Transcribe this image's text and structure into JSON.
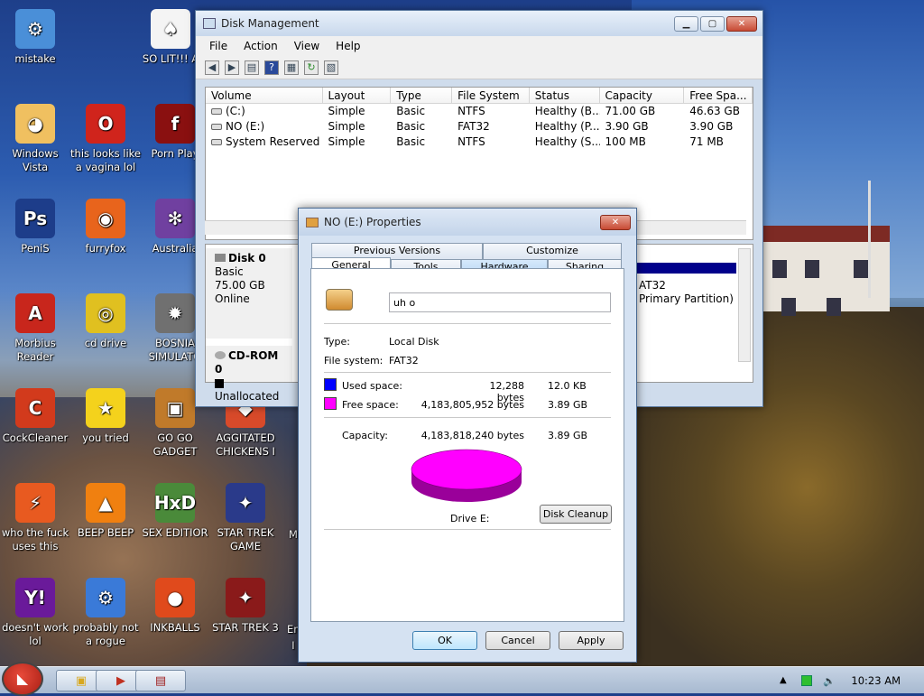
{
  "desktop": {
    "icons": [
      {
        "label": "mistake",
        "glyph": "⚙",
        "color": "#4a8fd8"
      },
      {
        "label": "SO LIT!!! A",
        "glyph": "♠",
        "color": "#f4f4f4"
      },
      {
        "label": "Windows Vista",
        "glyph": "◕",
        "color": "#f0c060"
      },
      {
        "label": "this looks like a vagina lol",
        "glyph": "O",
        "color": "#d0241c"
      },
      {
        "label": "Porn Play",
        "glyph": "f",
        "color": "#8a1010"
      },
      {
        "label": "PeniS",
        "glyph": "Ps",
        "color": "#1d3d8a"
      },
      {
        "label": "furryfox",
        "glyph": "◉",
        "color": "#e8641c"
      },
      {
        "label": "Australia",
        "glyph": "✻",
        "color": "#7040a0"
      },
      {
        "label": "Morbius Reader",
        "glyph": "A",
        "color": "#c8261c"
      },
      {
        "label": "cd drive",
        "glyph": "◎",
        "color": "#e0c020"
      },
      {
        "label": "BOSNIA SIMULATO",
        "glyph": "✹",
        "color": "#707070"
      },
      {
        "label": "CockCleaner",
        "glyph": "C",
        "color": "#d23a1c"
      },
      {
        "label": "you tried",
        "glyph": "★",
        "color": "#f4d21c"
      },
      {
        "label": "GO GO GADGET",
        "glyph": "▣",
        "color": "#c07a2a"
      },
      {
        "label": "AGGITATED CHICKENS I",
        "glyph": "◆",
        "color": "#d84a2a"
      },
      {
        "label": "who the fuck uses this",
        "glyph": "⚡",
        "color": "#e85a20"
      },
      {
        "label": "BEEP BEEP",
        "glyph": "▲",
        "color": "#f08010"
      },
      {
        "label": "SEX EDITIOR",
        "glyph": "HxD",
        "color": "#4a8a3a"
      },
      {
        "label": "STAR TREK GAME",
        "glyph": "✦",
        "color": "#2a3a8a"
      },
      {
        "label": "doesn't work lol",
        "glyph": "Y!",
        "color": "#6a1a9a"
      },
      {
        "label": "probably not a rogue",
        "glyph": "⚙",
        "color": "#3a7ad8"
      },
      {
        "label": "INKBALLS",
        "glyph": "●",
        "color": "#e04a1c"
      },
      {
        "label": "STAR TREK 3",
        "glyph": "✦",
        "color": "#8a1a1a"
      }
    ],
    "cut_labels": [
      "M",
      "Em",
      "I"
    ]
  },
  "disk_mgmt": {
    "title": "Disk Management",
    "menu": [
      "File",
      "Action",
      "View",
      "Help"
    ],
    "toolbar_icons": [
      "back-icon",
      "forward-icon",
      "view-icon",
      "help-icon",
      "properties-icon",
      "refresh-icon",
      "settings-icon"
    ],
    "columns": [
      "Volume",
      "Layout",
      "Type",
      "File System",
      "Status",
      "Capacity",
      "Free Spa..."
    ],
    "rows": [
      [
        "(C:)",
        "Simple",
        "Basic",
        "NTFS",
        "Healthy (B...",
        "71.00 GB",
        "46.63 GB"
      ],
      [
        "NO (E:)",
        "Simple",
        "Basic",
        "FAT32",
        "Healthy (P...",
        "3.90 GB",
        "3.90 GB"
      ],
      [
        "System Reserved",
        "Simple",
        "Basic",
        "NTFS",
        "Healthy (S...",
        "100 MB",
        "71 MB"
      ]
    ],
    "disk0": {
      "name": "Disk 0",
      "type": "Basic",
      "size": "75.00 GB",
      "status": "Online"
    },
    "cdrom": {
      "name": "CD-ROM 0",
      "status": "Unallocated"
    },
    "partition_text": [
      "AT32",
      "Primary Partition)"
    ]
  },
  "properties": {
    "title": "NO (E:) Properties",
    "tabs_top": [
      "Previous Versions",
      "Customize"
    ],
    "tabs_bottom": [
      "General",
      "Tools",
      "Hardware",
      "Sharing"
    ],
    "name_value": "uh o",
    "type_label": "Type:",
    "type_value": "Local Disk",
    "fs_label": "File system:",
    "fs_value": "FAT32",
    "used_label": "Used space:",
    "used_bytes": "12,288 bytes",
    "used_size": "12.0 KB",
    "free_label": "Free space:",
    "free_bytes": "4,183,805,952 bytes",
    "free_size": "3.89 GB",
    "cap_label": "Capacity:",
    "cap_bytes": "4,183,818,240 bytes",
    "cap_size": "3.89 GB",
    "drive_label": "Drive E:",
    "cleanup_button": "Disk Cleanup",
    "ok": "OK",
    "cancel": "Cancel",
    "apply": "Apply",
    "used_color": "#0000ff",
    "free_color": "#ff00ff"
  },
  "taskbar": {
    "start_icon": "angry-bird-start-icon",
    "tasks": [
      "explorer-icon",
      "media-icon",
      "disk-mgmt-icon"
    ],
    "clock": "10:23 AM"
  }
}
